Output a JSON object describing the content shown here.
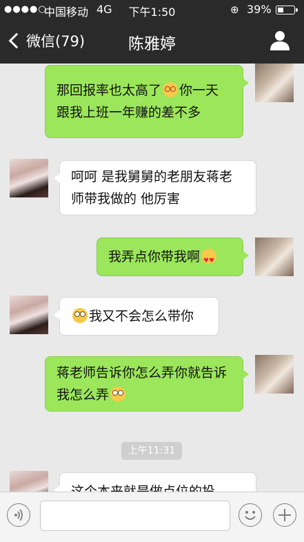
{
  "status": {
    "signal": "●●●●○",
    "carrier": "中国移动",
    "network": "4G",
    "time": "下午1:50",
    "battery_pct": "39%",
    "battery_level": 0.39
  },
  "nav": {
    "back_label": "微信(79)",
    "title": "陈雅婷"
  },
  "messages": [
    {
      "side": "out",
      "text_a": "那回报率也太高了",
      "emoji": "dizzy",
      "text_b": "你一天跟我上班一年赚的差不多"
    },
    {
      "side": "in",
      "text": "呵呵  是我舅舅的老朋友蒋老师带我做的  他厉害"
    },
    {
      "side": "out",
      "text_a": "我弄点你带我啊",
      "emoji": "love"
    },
    {
      "side": "in",
      "emoji": "roll",
      "text_b": "我又不会怎么带你"
    },
    {
      "side": "out",
      "text_a": "蒋老师告诉你怎么弄你就告诉我怎么弄",
      "emoji": "roll"
    },
    {
      "side": "in",
      "text": "这个本来就是做点位的投"
    }
  ],
  "timestamp": "上午11:31",
  "input": {
    "value": ""
  },
  "icons": {
    "voice": "voice-icon",
    "emoji": "emoji-icon",
    "more": "plus-icon",
    "profile": "person-icon",
    "back": "chevron-left-icon"
  }
}
